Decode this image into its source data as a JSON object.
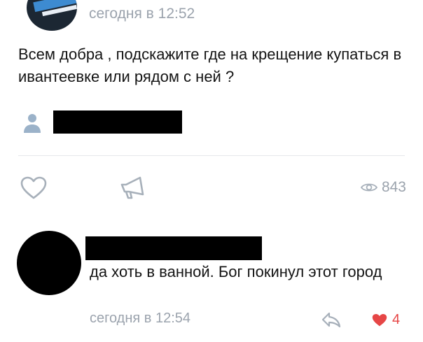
{
  "post": {
    "time": "сегодня в 12:52",
    "text": "Всем добра , подскажите где на крещение купаться в ивантеевке или рядом с ней ?",
    "views": "843"
  },
  "comment": {
    "text": "да хоть в ванной. Бог покинул этот город",
    "time": "сегодня в 12:54",
    "likes": "4"
  },
  "colors": {
    "meta_gray": "#9ba3ad",
    "icon_gray": "#a7b0ba",
    "like_red": "#e64646",
    "divider": "#e6e8eb",
    "person_icon_blue": "#9bb2c9"
  },
  "icons": {
    "like": "heart-outline-icon",
    "share": "megaphone-icon",
    "views": "eye-icon",
    "reply": "reply-arrow-icon",
    "comment_like": "heart-filled-icon",
    "author": "person-icon"
  }
}
